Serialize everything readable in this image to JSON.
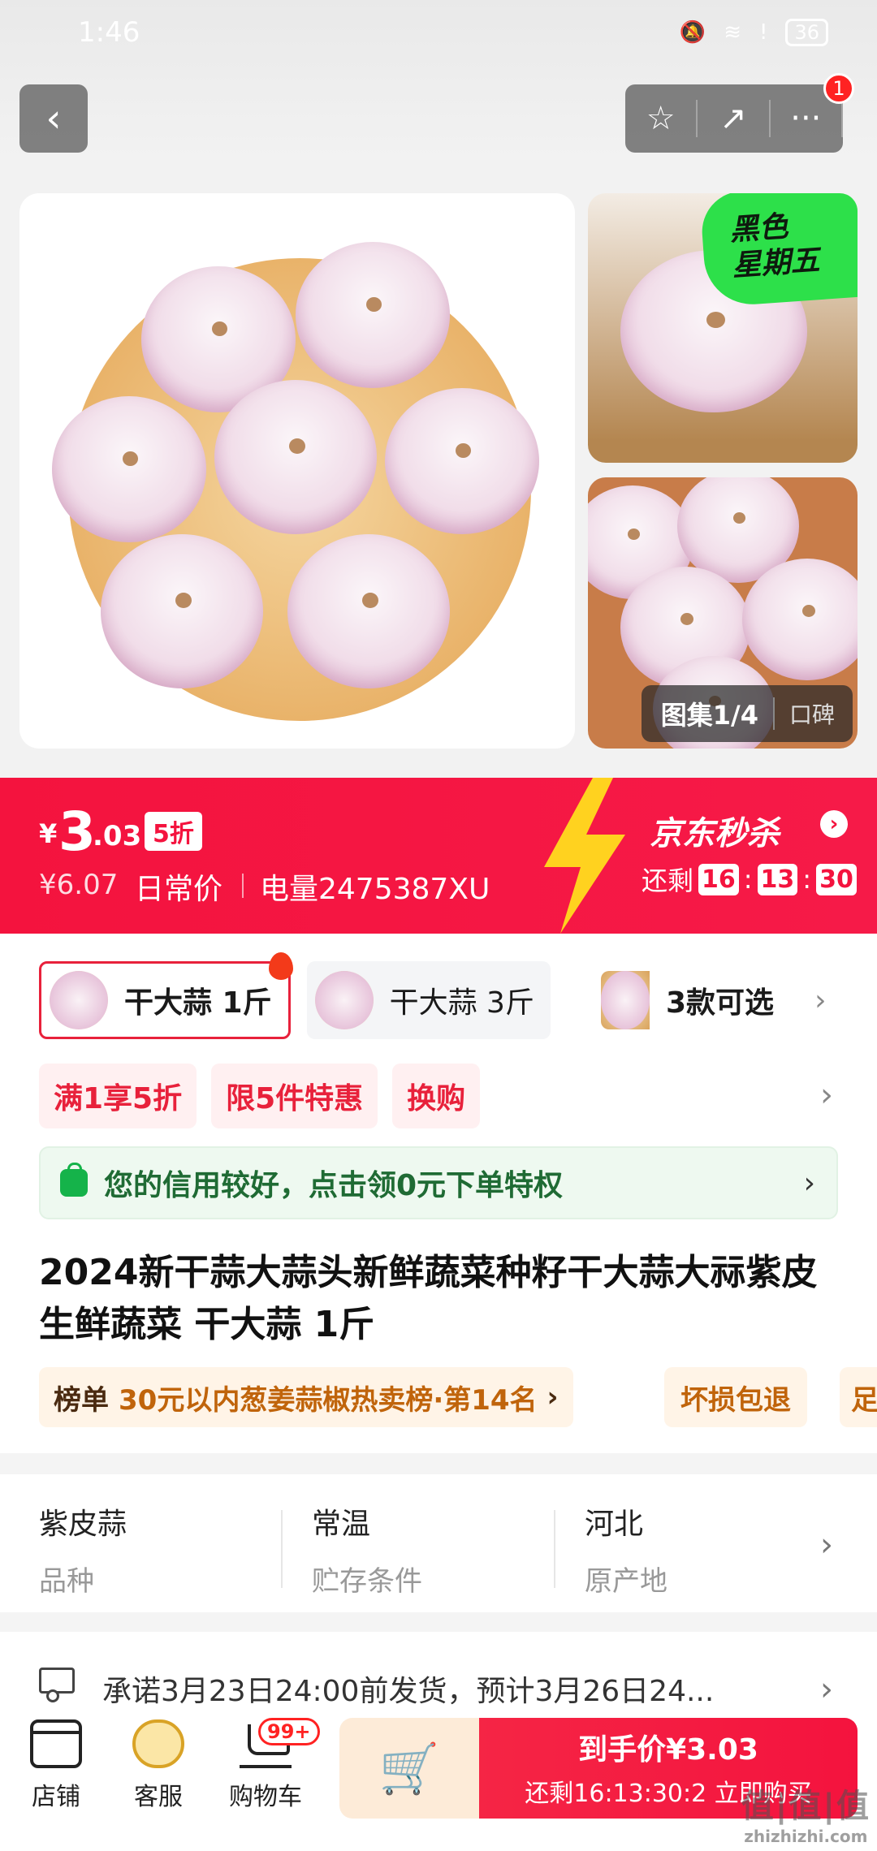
{
  "status": {
    "time": "1:46",
    "battery": "36"
  },
  "nav": {
    "back_label": "‹",
    "favorite_icon": "☆",
    "share_icon": "↗",
    "more_icon": "···",
    "badge_count": "1"
  },
  "media": {
    "promo_tag_line1": "黑色",
    "promo_tag_line2": "星期五",
    "gallery_counter": "图集1/4",
    "reviews_tab": "口碑"
  },
  "price": {
    "currency": "¥",
    "current_int": "3",
    "current_dec": ".03",
    "discount": "5折",
    "original": "¥6.07",
    "original_label": "日常价",
    "sku_code": "电量2475387XU",
    "seckill_title": "京东秒杀",
    "remain_label": "还剩",
    "countdown": {
      "h": "16",
      "m": "13",
      "s": "30"
    },
    "accent": "#f4133e"
  },
  "skus": [
    {
      "label": "干大蒜 1斤",
      "active": true
    },
    {
      "label": "干大蒜 3斤",
      "active": false
    }
  ],
  "more_skus": "3款可选",
  "promos": [
    "满1享5折",
    "限5件特惠",
    "换购"
  ],
  "credit_banner": "您的信用较好，点击领0元下单特权",
  "product_title": "2024新干蒜大蒜头新鲜蔬菜种籽干大蒜大祘紫皮生鲜蔬菜 干大蒜 1斤",
  "ranking": {
    "label": "榜单",
    "text": "30元以内葱姜蒜椒热卖榜·第14名"
  },
  "tags": [
    "坏损包退",
    "足"
  ],
  "attributes": [
    {
      "value": "紫皮蒜",
      "label": "品种"
    },
    {
      "value": "常温",
      "label": "贮存条件"
    },
    {
      "value": "河北",
      "label": "原产地"
    }
  ],
  "delivery": "承诺3月23日24:00前发货，预计3月26日24...",
  "bottom": {
    "store": "店铺",
    "service": "客服",
    "cart": "购物车",
    "cart_badge": "99+",
    "buy_line1": "到手价¥3.03",
    "buy_line2": "还剩16:13:30:2 立即购买"
  },
  "watermark": {
    "big": "值|值|值",
    "small": "zhizhizhi.com"
  }
}
